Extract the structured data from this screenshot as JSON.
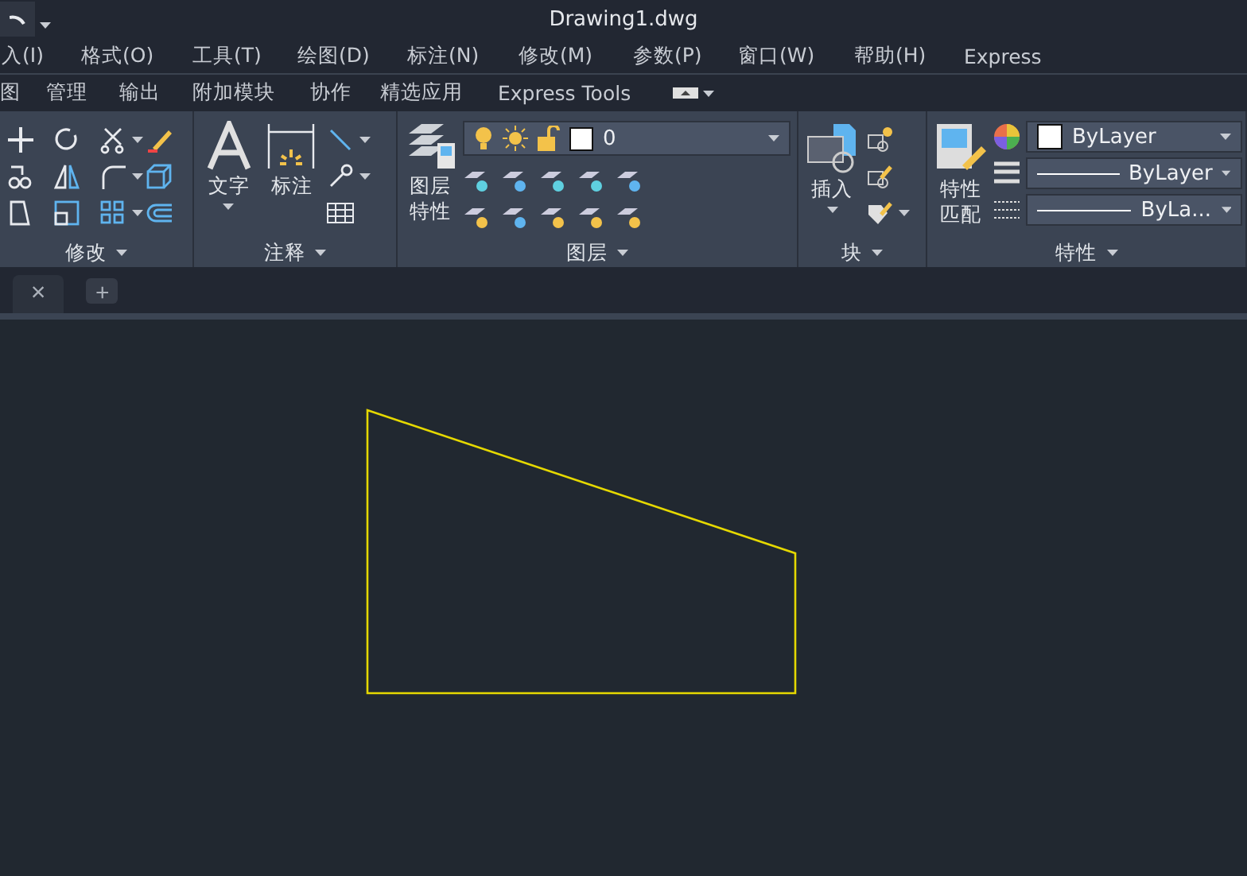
{
  "window": {
    "title": "Drawing1.dwg"
  },
  "menu": [
    "入(I)",
    "格式(O)",
    "工具(T)",
    "绘图(D)",
    "标注(N)",
    "修改(M)",
    "参数(P)",
    "窗口(W)",
    "帮助(H)",
    "Express"
  ],
  "ribbon_tabs": [
    "图",
    "管理",
    "输出",
    "附加模块",
    "协作",
    "精选应用",
    "Express Tools"
  ],
  "panels": [
    {
      "kind": "modify",
      "title": "修改"
    },
    {
      "kind": "annotate",
      "title": "注释",
      "buttons": [
        "文字",
        "标注"
      ]
    },
    {
      "kind": "layers",
      "title": "图层",
      "button": "图层特性",
      "layer": "0"
    },
    {
      "kind": "block",
      "title": "块",
      "button": "插入"
    },
    {
      "kind": "properties",
      "title": "特性",
      "button": "特性匹配",
      "combos": [
        "ByLayer",
        "ByLayer",
        "ByLa..."
      ]
    }
  ],
  "doc_tabs": {
    "close": "×",
    "add": "+"
  }
}
